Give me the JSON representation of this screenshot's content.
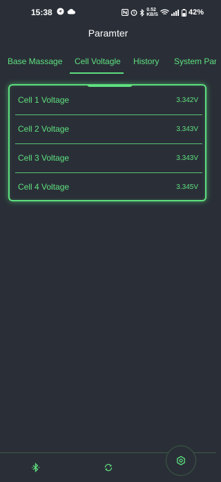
{
  "status_bar": {
    "time": "15:38",
    "net_speed_value": "0.52",
    "net_speed_unit": "KB/S",
    "battery": "42%"
  },
  "header": {
    "title": "Paramter"
  },
  "tabs": [
    {
      "label": "Base Massage"
    },
    {
      "label": "Cell Voltagle"
    },
    {
      "label": "History"
    },
    {
      "label": "System Para"
    }
  ],
  "active_tab": "Cell Voltagle",
  "cells": [
    {
      "label": "Cell 1 Voltage",
      "value": "3.342V"
    },
    {
      "label": "Cell 2 Voltage",
      "value": "3.343V"
    },
    {
      "label": "Cell 3 Voltage",
      "value": "3.343V"
    },
    {
      "label": "Cell 4 Voltage",
      "value": "3.345V"
    }
  ],
  "bottom_nav": {
    "items": [
      {
        "icon": "bluetooth-icon"
      },
      {
        "icon": "refresh-icon"
      },
      {
        "icon": "settings-icon"
      }
    ]
  },
  "colors": {
    "accent": "#5ee07f",
    "background": "#2a2f37",
    "text_primary": "#ffffff"
  }
}
